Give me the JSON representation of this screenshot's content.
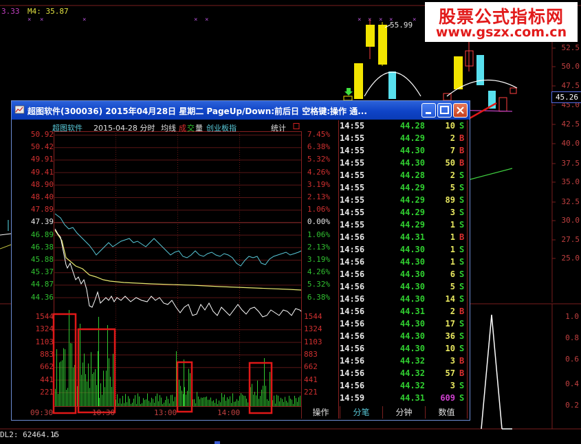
{
  "background": {
    "m_label_left": "3.33",
    "m_label": "M4: 35.87",
    "ma_label": "55.99",
    "right_axis": [
      "52.5",
      "50.0",
      "47.5",
      "45.0",
      "42.5",
      "40.0",
      "37.5",
      "35.0",
      "32.5",
      "30.0",
      "27.5",
      "25.0"
    ],
    "current_price_badge": "45.26",
    "indicator_axis": [
      "1.0",
      "0.8",
      "0.6",
      "0.4",
      "0.2"
    ],
    "status_text": "DL2: 62464.15"
  },
  "watermark": {
    "line1": "股票公式指标网",
    "line2": "www.gszx.com.cn"
  },
  "popup": {
    "title": "超图软件(300036) 2015年04月28日 星期二 PageUp/Down:前后日 空格键:操作 通...",
    "header": {
      "name": "超图软件",
      "date": "2015-04-28 分时",
      "avg_label": "均线",
      "vol_label_1": "成",
      "vol_label_2": "交",
      "vol_label_3": "量",
      "index_label": "创业板指",
      "stats_label": "统计"
    },
    "price_axis_left": [
      "50.92",
      "50.42",
      "49.91",
      "49.41",
      "48.90",
      "48.40",
      "47.89",
      "47.39",
      "46.89",
      "46.38",
      "45.88",
      "45.37",
      "44.87",
      "44.36"
    ],
    "pct_axis_right": [
      "7.45%",
      "6.38%",
      "5.32%",
      "4.26%",
      "3.19%",
      "2.13%",
      "1.06%",
      "0.00%",
      "1.06%",
      "2.13%",
      "3.19%",
      "4.26%",
      "5.32%",
      "6.38%"
    ],
    "volume_axis": [
      "1544",
      "1324",
      "1103",
      "883",
      "662",
      "441",
      "221"
    ],
    "time_axis": [
      "09:30",
      "10:30",
      "13:00",
      "14:00"
    ],
    "tabs": [
      "操作",
      "分笔",
      "分钟",
      "数值"
    ],
    "ticks": [
      {
        "time": "14:55",
        "price": "44.28",
        "vol": "10",
        "dir": "S"
      },
      {
        "time": "14:55",
        "price": "44.29",
        "vol": "2",
        "dir": "B"
      },
      {
        "time": "14:55",
        "price": "44.30",
        "vol": "7",
        "dir": "B"
      },
      {
        "time": "14:55",
        "price": "44.30",
        "vol": "50",
        "dir": "B"
      },
      {
        "time": "14:55",
        "price": "44.28",
        "vol": "2",
        "dir": "S"
      },
      {
        "time": "14:55",
        "price": "44.29",
        "vol": "5",
        "dir": "S"
      },
      {
        "time": "14:55",
        "price": "44.29",
        "vol": "89",
        "dir": "S"
      },
      {
        "time": "14:55",
        "price": "44.29",
        "vol": "3",
        "dir": "S"
      },
      {
        "time": "14:55",
        "price": "44.29",
        "vol": "1",
        "dir": "S"
      },
      {
        "time": "14:56",
        "price": "44.31",
        "vol": "1",
        "dir": "B"
      },
      {
        "time": "14:56",
        "price": "44.30",
        "vol": "1",
        "dir": "S"
      },
      {
        "time": "14:56",
        "price": "44.30",
        "vol": "1",
        "dir": "S"
      },
      {
        "time": "14:56",
        "price": "44.30",
        "vol": "6",
        "dir": "S"
      },
      {
        "time": "14:56",
        "price": "44.30",
        "vol": "5",
        "dir": "S"
      },
      {
        "time": "14:56",
        "price": "44.30",
        "vol": "14",
        "dir": "S"
      },
      {
        "time": "14:56",
        "price": "44.31",
        "vol": "2",
        "dir": "B"
      },
      {
        "time": "14:56",
        "price": "44.30",
        "vol": "17",
        "dir": "S"
      },
      {
        "time": "14:56",
        "price": "44.30",
        "vol": "36",
        "dir": "S"
      },
      {
        "time": "14:56",
        "price": "44.30",
        "vol": "10",
        "dir": "S"
      },
      {
        "time": "14:56",
        "price": "44.32",
        "vol": "3",
        "dir": "B"
      },
      {
        "time": "14:56",
        "price": "44.32",
        "vol": "57",
        "dir": "B"
      },
      {
        "time": "14:56",
        "price": "44.32",
        "vol": "3",
        "dir": "S"
      },
      {
        "time": "14:59",
        "price": "44.31",
        "vol": "609",
        "dir": "S"
      }
    ]
  }
}
